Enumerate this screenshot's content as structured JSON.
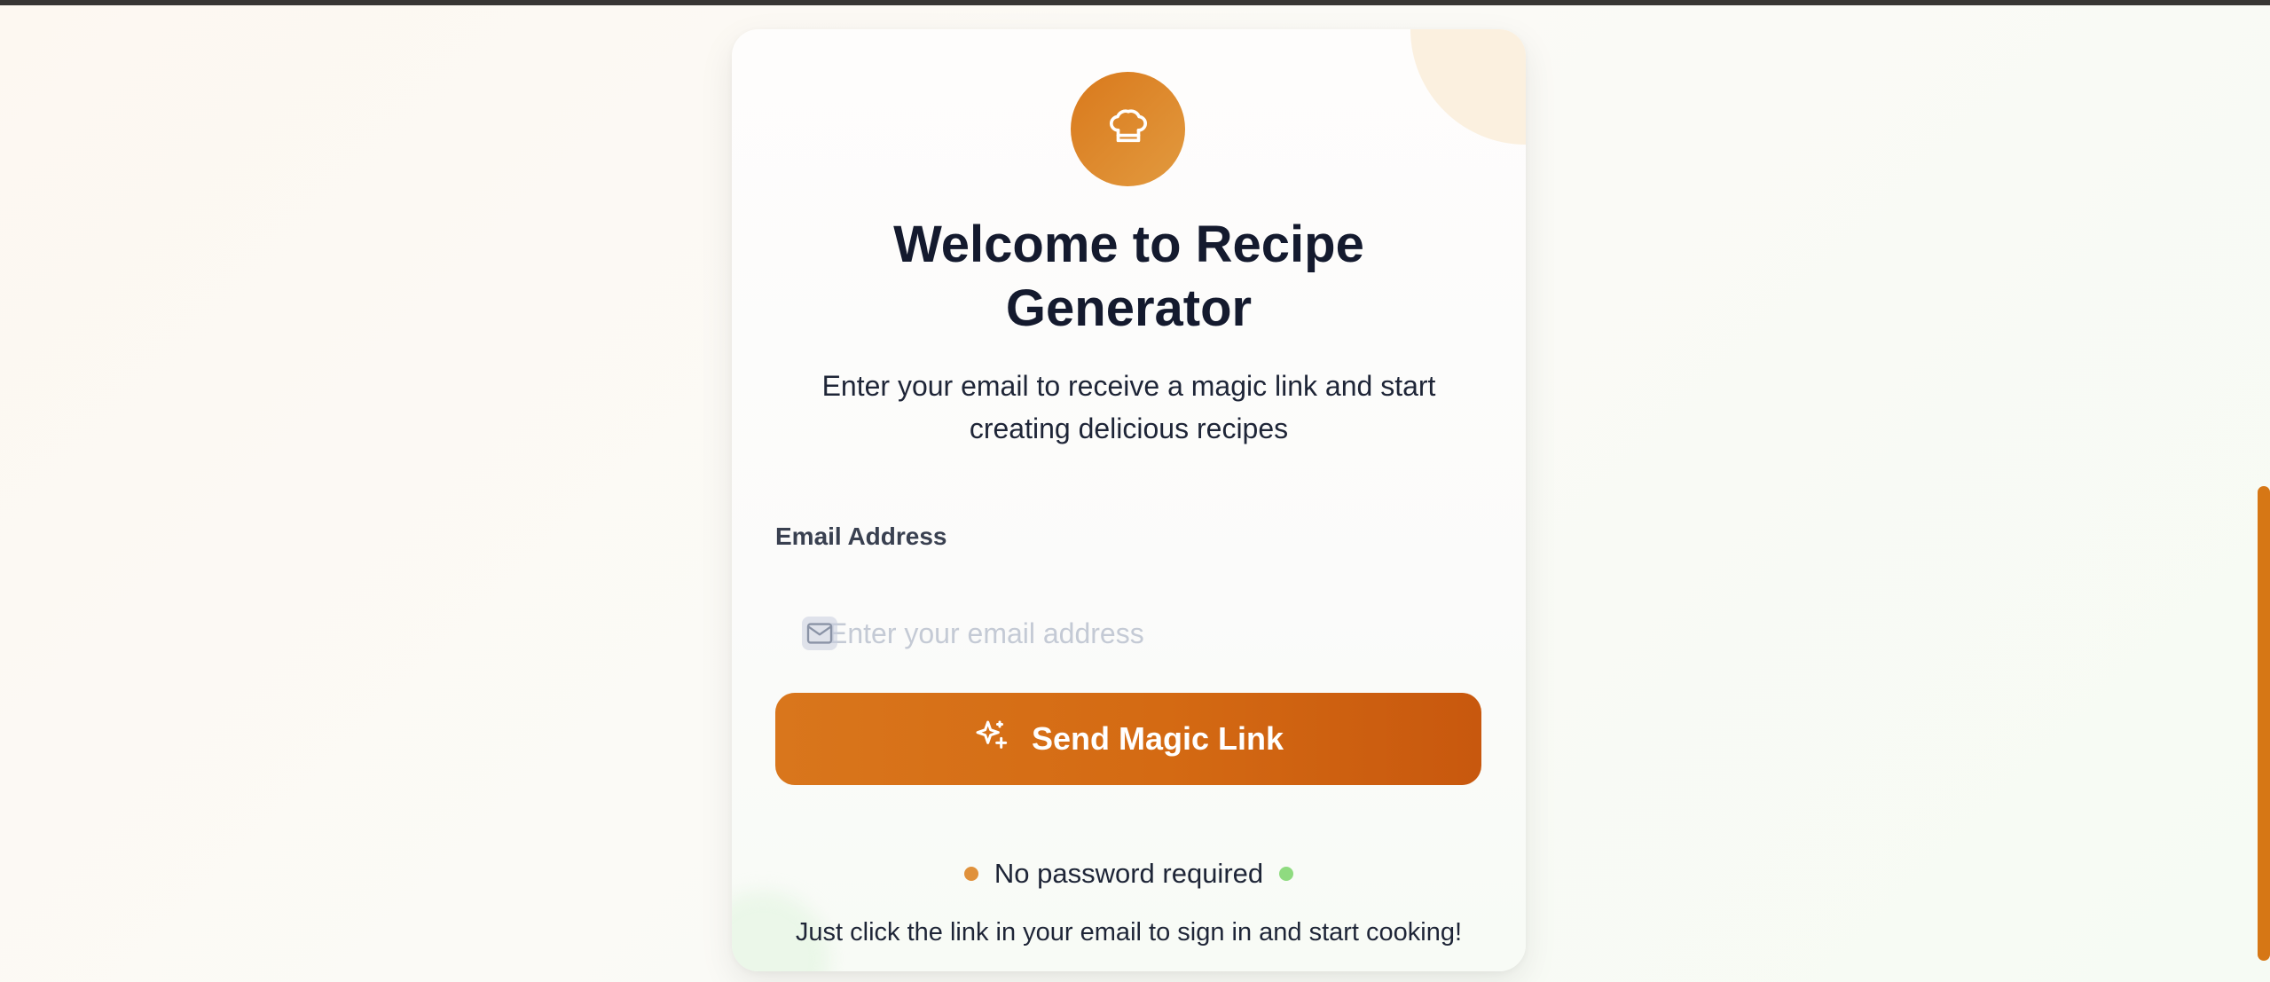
{
  "login": {
    "title": "Welcome to Recipe Generator",
    "subtitle": "Enter your email to receive a magic link and start creating delicious recipes",
    "email_label": "Email Address",
    "email_placeholder": "Enter your email address",
    "email_value": "",
    "send_button_label": "Send Magic Link",
    "feature_text": "No password required",
    "hint_text": "Just click the link in your email to sign in and start cooking!"
  },
  "icons": {
    "logo": "chef-hat-icon",
    "email": "mail-icon",
    "button": "sparkles-icon"
  },
  "colors": {
    "accent": "#d67715",
    "accent_dark": "#c8580e",
    "title": "#141a2e",
    "dot_orange": "#e0913b",
    "dot_green": "#8fdb80"
  }
}
